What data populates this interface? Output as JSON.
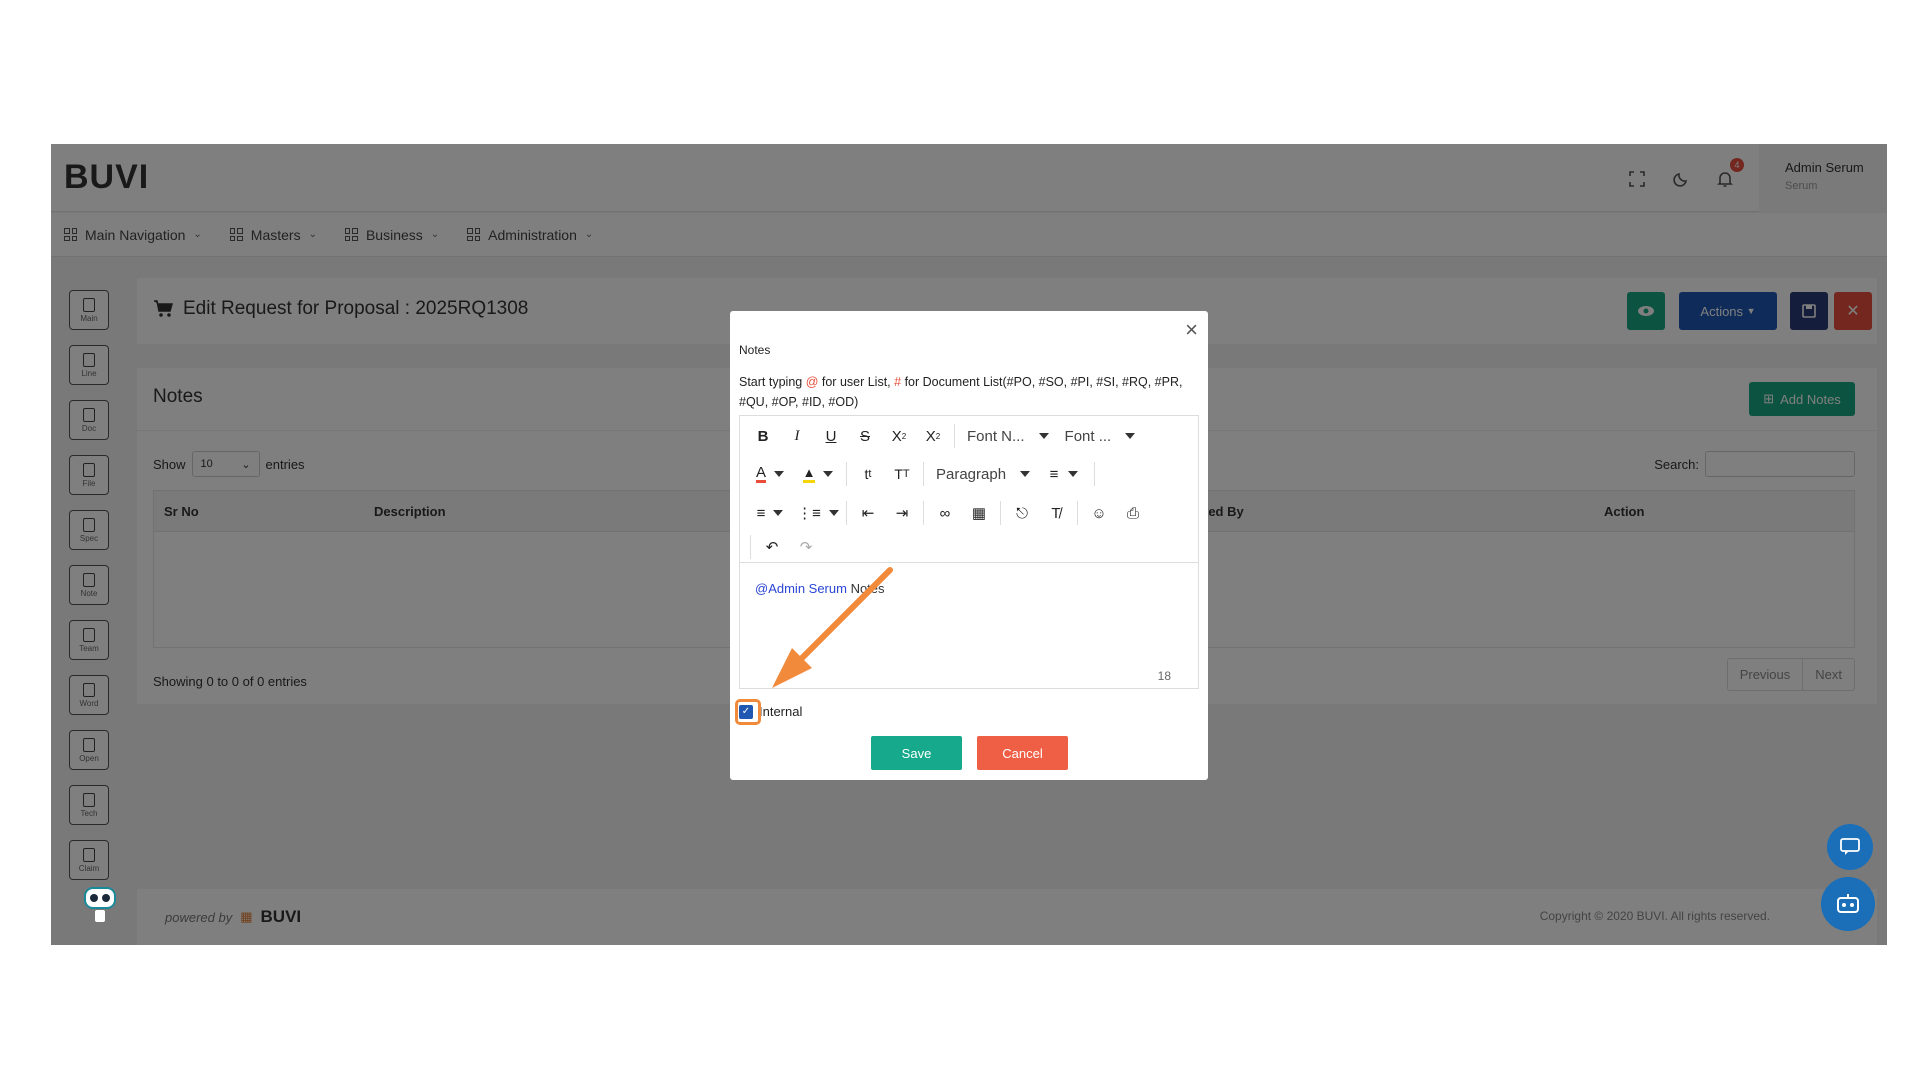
{
  "header": {
    "logo": "BUVI",
    "notification_count": "4",
    "user_name": "Admin Serum",
    "user_role": "Serum"
  },
  "nav": [
    {
      "label": "Main Navigation"
    },
    {
      "label": "Masters"
    },
    {
      "label": "Business"
    },
    {
      "label": "Administration"
    }
  ],
  "rail": [
    {
      "label": "Main"
    },
    {
      "label": "Line"
    },
    {
      "label": "Doc"
    },
    {
      "label": "File"
    },
    {
      "label": "Spec"
    },
    {
      "label": "Note"
    },
    {
      "label": "Team"
    },
    {
      "label": "Word"
    },
    {
      "label": "Open"
    },
    {
      "label": "Tech"
    },
    {
      "label": "Claim"
    }
  ],
  "page": {
    "title": "Edit Request for Proposal : 2025RQ1308",
    "actions_label": "Actions"
  },
  "notes": {
    "title": "Notes",
    "add_label": "Add Notes",
    "show_label": "Show",
    "show_value": "10",
    "entries_label": "entries",
    "search_label": "Search:",
    "columns": [
      "Sr No",
      "Description",
      "Created By",
      "Action"
    ],
    "columns_visible": [
      "Sr No",
      "Description",
      "ted By",
      "Action"
    ],
    "showing": "Showing 0 to 0 of 0 entries",
    "prev": "Previous",
    "next": "Next"
  },
  "footer": {
    "powered": "powered by",
    "brand": "BUVI",
    "copyright": "Copyright © 2020 BUVI. All rights reserved."
  },
  "modal": {
    "title": "Notes",
    "hint_part1": "Start typing ",
    "hint_at": "@",
    "hint_part2": " for user List, ",
    "hint_hash": "#",
    "hint_part3": " for Document List(#PO, #SO, #PI, #SI, #RQ, #PR, #QU, #OP, #ID, #OD)",
    "font_name": "Font N...",
    "font_size": "Font ...",
    "block": "Paragraph",
    "content_mention": "@Admin Serum",
    "content_text": " Notes",
    "char_count": "18",
    "internal_label": "Internal",
    "internal_checked": true,
    "save_label": "Save",
    "cancel_label": "Cancel"
  },
  "colors": {
    "accent_green": "#17a98b",
    "cancel_red": "#ef5f45",
    "actions_blue": "#1f57b3",
    "highlight_orange": "#f28a3b"
  }
}
